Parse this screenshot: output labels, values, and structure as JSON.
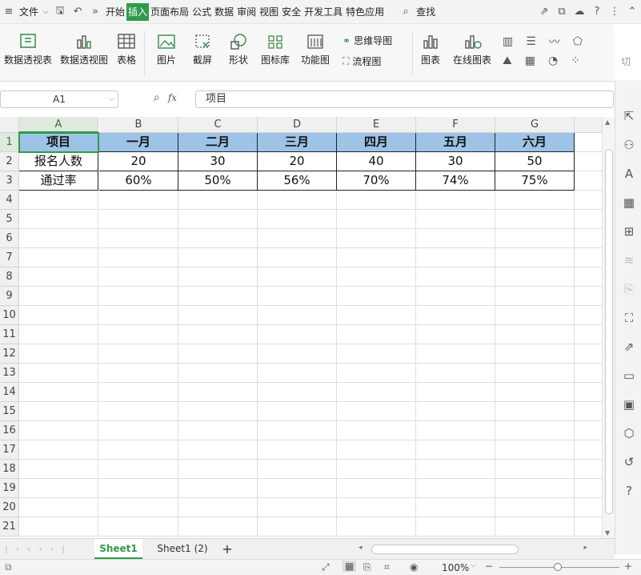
{
  "menubar": {
    "file": "文件",
    "tabs": [
      "开始",
      "插入",
      "页面布局",
      "公式",
      "数据",
      "审阅",
      "视图",
      "安全",
      "开发工具",
      "特色应用"
    ],
    "active_tab": "插入",
    "search": "查找"
  },
  "ribbon": {
    "pivot_table": "数据透视表",
    "pivot_chart": "数据透视图",
    "table": "表格",
    "picture": "图片",
    "screenshot": "截屏",
    "shape": "形状",
    "icon_lib": "图标库",
    "func_chart": "功能图",
    "mindmap": "思维导图",
    "flowchart": "流程图",
    "chart": "图表",
    "online_chart": "在线图表",
    "cut": "切"
  },
  "formula_bar": {
    "name_box": "A1",
    "fx": "fx",
    "value": "项目"
  },
  "sheet": {
    "columns": [
      "A",
      "B",
      "C",
      "D",
      "E",
      "F",
      "G"
    ],
    "rows": [
      "1",
      "2",
      "3",
      "4",
      "5",
      "6",
      "7",
      "8",
      "9",
      "10",
      "11",
      "12",
      "13",
      "14",
      "15",
      "16",
      "17",
      "18",
      "19",
      "20",
      "21"
    ],
    "table": [
      [
        "项目",
        "一月",
        "二月",
        "三月",
        "四月",
        "五月",
        "六月"
      ],
      [
        "报名人数",
        "20",
        "30",
        "20",
        "40",
        "30",
        "50"
      ],
      [
        "通过率",
        "60%",
        "50%",
        "56%",
        "70%",
        "74%",
        "75%"
      ]
    ]
  },
  "tabs": {
    "sheets": [
      "Sheet1",
      "Sheet1 (2)"
    ],
    "add": "+"
  },
  "status": {
    "zoom": "100%"
  },
  "colors": {
    "accent": "#2f9b47",
    "header_fill": "#9dc3e6"
  }
}
